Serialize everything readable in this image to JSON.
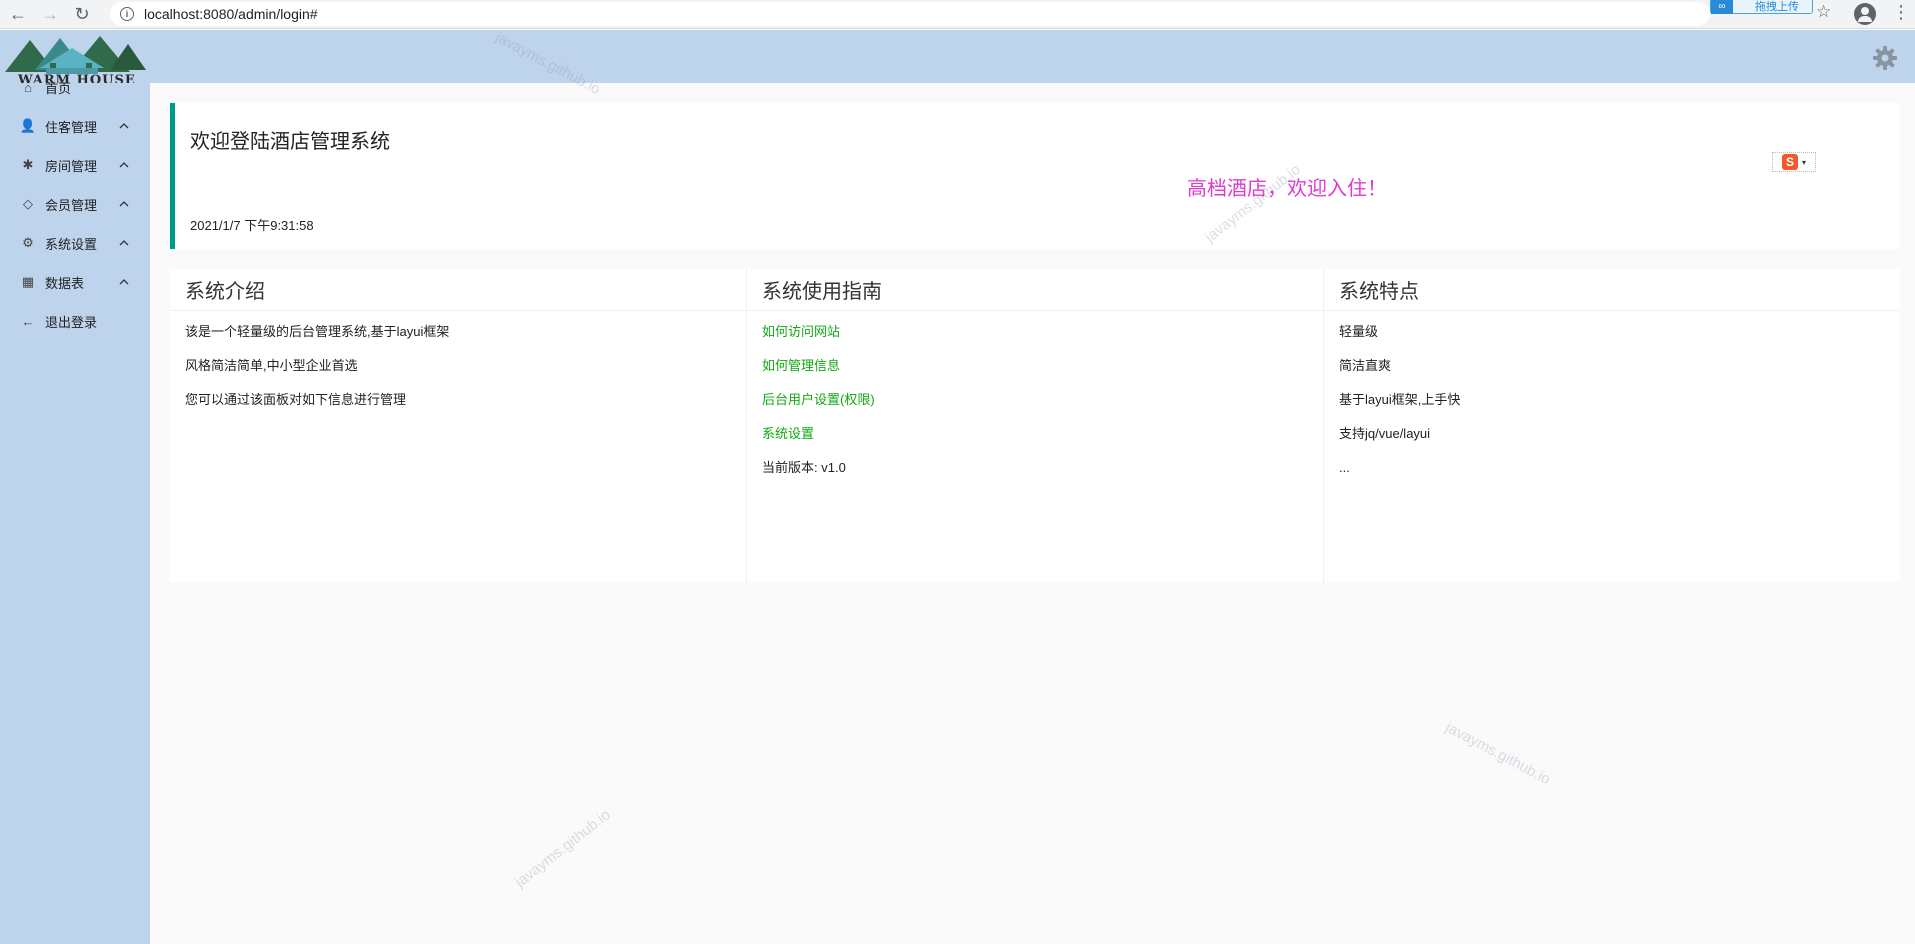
{
  "browser": {
    "url": "localhost:8080/admin/login#",
    "extension_label": "拖拽上传",
    "back_glyph": "←",
    "forward_glyph": "→",
    "reload_glyph": "↻",
    "info_glyph": "i",
    "star_glyph": "☆",
    "menu_glyph": "⋮"
  },
  "header": {
    "logo_text": "WARM HOUSE",
    "settings_icon": "gear-icon"
  },
  "sidebar": {
    "items": [
      {
        "label": "首页",
        "icon": "home-icon",
        "glyph": "⌂",
        "expandable": false
      },
      {
        "label": "住客管理",
        "icon": "user-icon",
        "glyph": "👤",
        "expandable": true
      },
      {
        "label": "房间管理",
        "icon": "palm-icon",
        "glyph": "✱",
        "expandable": true
      },
      {
        "label": "会员管理",
        "icon": "diamond-icon",
        "glyph": "◇",
        "expandable": true
      },
      {
        "label": "系统设置",
        "icon": "gear-icon",
        "glyph": "⚙",
        "expandable": true
      },
      {
        "label": "数据表",
        "icon": "table-icon",
        "glyph": "▦",
        "expandable": true
      },
      {
        "label": "退出登录",
        "icon": "arrow-left-icon",
        "glyph": "←",
        "expandable": false
      }
    ]
  },
  "welcome": {
    "title": "欢迎登陆酒店管理系统",
    "datetime": "2021/1/7 下午9:31:58",
    "marquee": "高档酒店，欢迎入住！",
    "input_method_logo": "S",
    "input_method_caret": "▾"
  },
  "panels": [
    {
      "title": "系统介绍",
      "lines": [
        {
          "text": "该是一个轻量级的后台管理系统,基于layui框架",
          "link": false
        },
        {
          "text": "风格简洁简单,中小型企业首选",
          "link": false
        },
        {
          "text": "您可以通过该面板对如下信息进行管理",
          "link": false
        }
      ]
    },
    {
      "title": "系统使用指南",
      "lines": [
        {
          "text": "如何访问网站",
          "link": true
        },
        {
          "text": "如何管理信息",
          "link": true
        },
        {
          "text": "后台用户设置(权限)",
          "link": true
        },
        {
          "text": "系统设置",
          "link": true
        },
        {
          "text": "当前版本: v1.0",
          "link": false
        }
      ]
    },
    {
      "title": "系统特点",
      "lines": [
        {
          "text": "轻量级",
          "link": false
        },
        {
          "text": "简洁直爽",
          "link": false
        },
        {
          "text": "基于layui框架,上手快",
          "link": false
        },
        {
          "text": "支持jq/vue/layui",
          "link": false
        },
        {
          "text": "...",
          "link": false
        }
      ]
    }
  ],
  "watermark": "javayms.github.io",
  "colors": {
    "sidebar_bg": "#bed3ec",
    "accent": "#009688",
    "link": "#11a811",
    "marquee": "#e03bd0"
  }
}
